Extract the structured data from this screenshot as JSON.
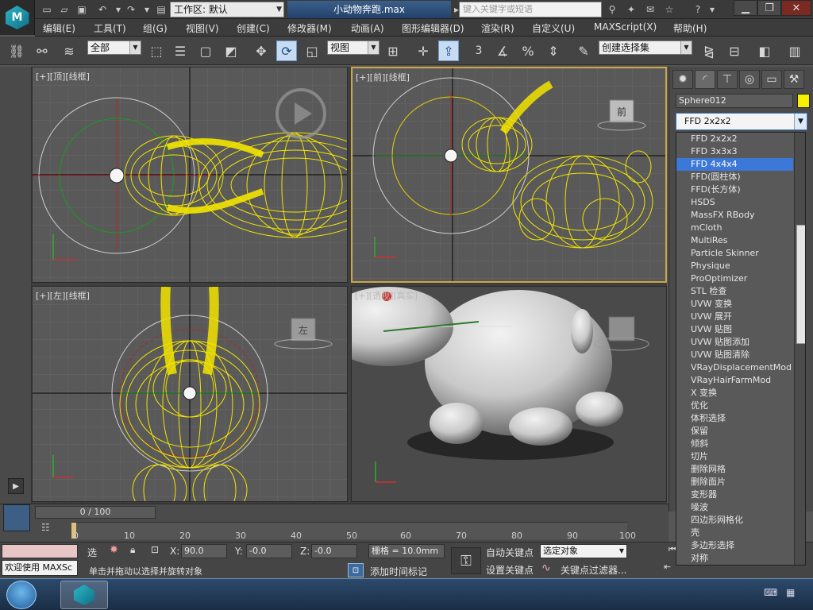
{
  "titlebar": {
    "workspace_label": "工作区: 默认",
    "file_name": "小动物奔跑.max",
    "search_placeholder": "键入关键字或短语"
  },
  "menu": [
    "编辑(E)",
    "工具(T)",
    "组(G)",
    "视图(V)",
    "创建(C)",
    "修改器(M)",
    "动画(A)",
    "图形编辑器(D)",
    "渲染(R)",
    "自定义(U)",
    "MAXScript(X)",
    "帮助(H)"
  ],
  "toolbar": {
    "selection_filter": "全部",
    "reference_coord": "视图",
    "named_selection": "创建选择集",
    "snap_value": "3",
    "percent_symbol": "%"
  },
  "viewports": {
    "top": "[+][顶][线框]",
    "front": "[+][前][线框]",
    "left": "[+][左][线框]",
    "persp": "[+][透视][真实]",
    "front_cube": "前",
    "left_cube": "左"
  },
  "command_panel": {
    "object_name": "Sphere012",
    "object_color": "#f4f000",
    "modifier_selected": "FFD 2x2x2",
    "modifiers": [
      "FFD 2x2x2",
      "FFD 3x3x3",
      "FFD 4x4x4",
      "FFD(圆柱体)",
      "FFD(长方体)",
      "HSDS",
      "MassFX RBody",
      "mCloth",
      "MultiRes",
      "Particle Skinner",
      "Physique",
      "ProOptimizer",
      "STL 检查",
      "UVW 变换",
      "UVW 展开",
      "UVW 贴图",
      "UVW 贴图添加",
      "UVW 贴图清除",
      "VRayDisplacementMod",
      "VRayHairFarmMod",
      "X 变换",
      "优化",
      "体积选择",
      "保留",
      "倾斜",
      "切片",
      "删除网格",
      "删除面片",
      "变形器",
      "噪波",
      "四边形网格化",
      "壳",
      "多边形选择",
      "对称"
    ],
    "highlighted_modifier": "FFD 4x4x4"
  },
  "timeline": {
    "frame": "0 / 100",
    "ticks": [
      "10",
      "20",
      "30",
      "40",
      "50",
      "60",
      "70",
      "80",
      "90",
      "100"
    ],
    "start_tick": "0"
  },
  "status": {
    "welcome": "欢迎使用 MAXSc",
    "selected_label": "选",
    "x_label": "X:",
    "x_value": "90.0",
    "y_label": "Y:",
    "y_value": "-0.0",
    "z_label": "Z:",
    "z_value": "-0.0",
    "grid": "栅格 = 10.0mm",
    "prompt": "单击并拖动以选择并旋转对象",
    "add_time_tag": "添加时间标记",
    "auto_key": "自动关键点",
    "set_key": "设置关键点",
    "key_mode": "选定对象",
    "key_filters": "关键点过滤器...",
    "frame_field": "0"
  },
  "colors": {
    "accent_blue": "#3c78d8",
    "wire_yellow": "#f0e000",
    "active_viewport": "#c9a745"
  }
}
